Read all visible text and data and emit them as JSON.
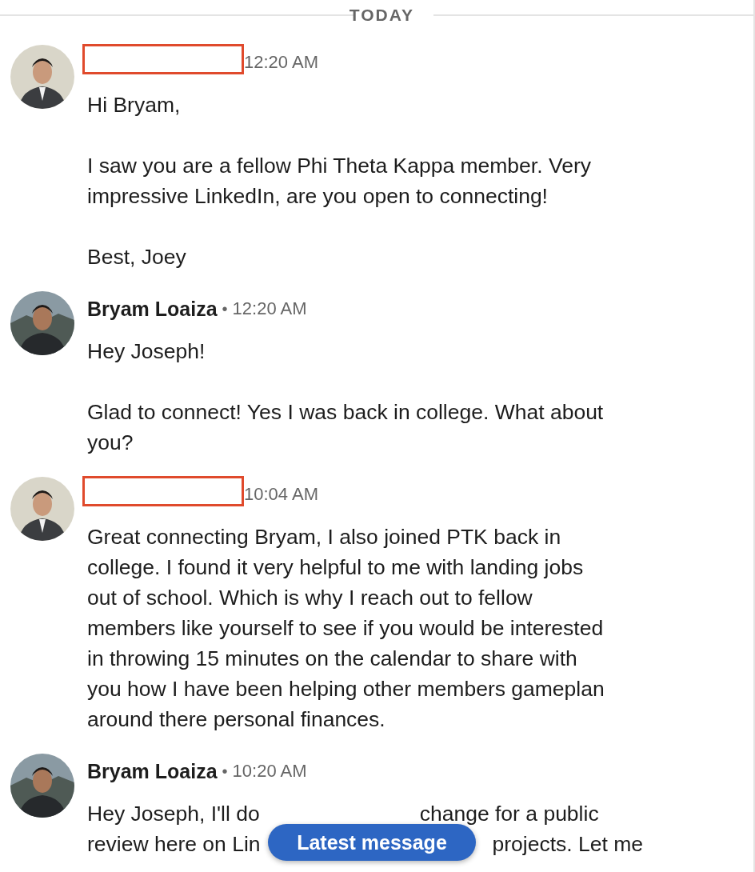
{
  "divider": {
    "label": "TODAY"
  },
  "messages": [
    {
      "avatar": {
        "kind": "picture"
      },
      "sender_redacted": true,
      "time": "12:20 AM",
      "paragraphs": [
        "Hi Bryam,",
        "I saw you are a fellow Phi Theta Kappa member. Very impressive LinkedIn, are you open to connecting!",
        "Best, Joey"
      ]
    },
    {
      "avatar": {
        "kind": "picture"
      },
      "sender": "Bryam Loaiza",
      "separator": "•",
      "time": "12:20 AM",
      "paragraphs": [
        "Hey Joseph!",
        "Glad to connect! Yes I was back in college. What about you?"
      ]
    },
    {
      "avatar": {
        "kind": "picture"
      },
      "sender_redacted": true,
      "time": "10:04 AM",
      "paragraphs": [
        "Great connecting Bryam, I also joined PTK back in college. I found it very helpful to me with landing jobs out of school. Which is why I reach out to fellow members like yourself to see if you would be interested in throwing 15 minutes on the calendar to share with you how I have been helping other members gameplan around there personal finances."
      ]
    },
    {
      "avatar": {
        "kind": "picture"
      },
      "sender": "Bryam Loaiza",
      "separator": "•",
      "time": "10:20 AM",
      "covered_lines": [
        [
          "Hey Joseph, I'll do",
          "change for a public"
        ],
        [
          "review here on Lin",
          "projects. Let me"
        ]
      ]
    }
  ],
  "latest_button": {
    "label": "Latest message"
  }
}
